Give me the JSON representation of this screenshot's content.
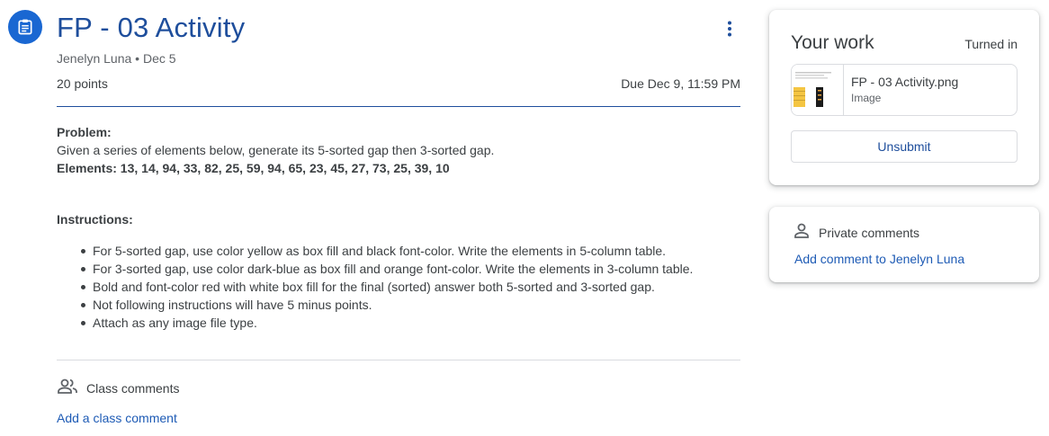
{
  "assignment": {
    "icon": "assignment-icon",
    "title": "FP - 03 Activity",
    "meta": "Jenelyn Luna • Dec 5",
    "points": "20 points",
    "due": "Due Dec 9, 11:59 PM",
    "accent_color": "#1e4e9c"
  },
  "description": {
    "problem_label": "Problem:",
    "problem_text": "Given a series of elements below, generate its 5-sorted gap then 3-sorted gap.",
    "elements_line": "Elements: 13, 14, 94, 33, 82, 25, 59, 94, 65, 23, 45, 27, 73, 25, 39, 10",
    "instructions_label": "Instructions:",
    "instructions": [
      "For 5-sorted gap, use color yellow as box fill and black font-color. Write the elements in 5-column table.",
      "For 3-sorted gap, use color dark-blue as box fill and orange font-color. Write the elements in 3-column table.",
      "Bold and font-color red with white box fill for the final (sorted) answer both 5-sorted and 3-sorted gap.",
      "Not following instructions will have 5 minus points.",
      "Attach as any image file type."
    ]
  },
  "class_comments": {
    "icon": "people-icon",
    "label": "Class comments",
    "add_link": "Add a class comment"
  },
  "your_work": {
    "title": "Your work",
    "status": "Turned in",
    "attachment": {
      "name": "FP - 03 Activity.png",
      "type": "Image"
    },
    "unsubmit_label": "Unsubmit"
  },
  "private_comments": {
    "icon": "person-icon",
    "label": "Private comments",
    "add_link": "Add comment to Jenelyn Luna"
  }
}
